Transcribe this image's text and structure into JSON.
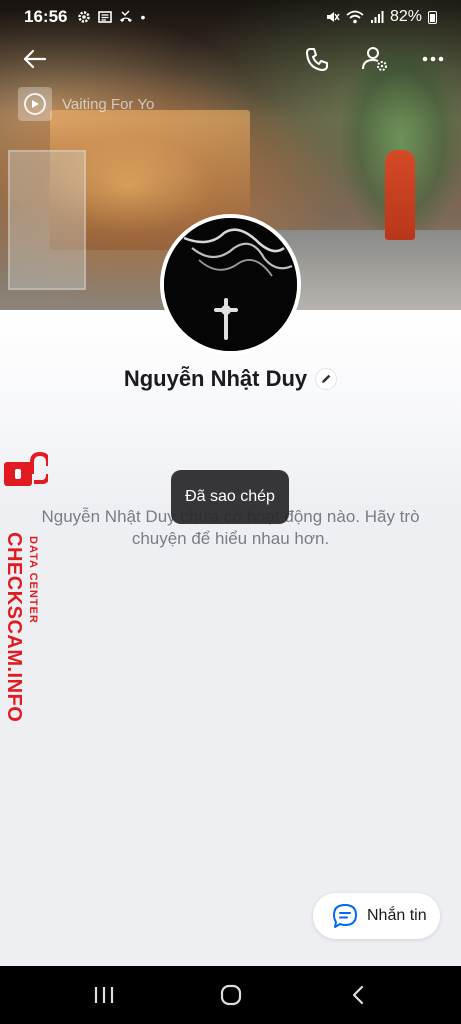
{
  "status_bar": {
    "time": "16:56",
    "dot": "•",
    "battery": "82%",
    "left_icons": [
      "gear-icon",
      "news-icon",
      "missed-call-icon"
    ],
    "right_icons": [
      "mute-icon",
      "wifi-icon",
      "signal-icon",
      "battery-icon"
    ]
  },
  "music": {
    "song": "Vaiting For Yo"
  },
  "profile": {
    "name": "Nguyễn Nhật Duy"
  },
  "empty_state": {
    "text": "Nguyễn Nhật Duy chưa có hoạt động nào. Hãy trò chuyện để hiểu nhau hơn."
  },
  "toast": {
    "text": "Đã sao chép"
  },
  "watermark": {
    "main": "CHECKSCAM.INFO",
    "sub": "DATA CENTER"
  },
  "actions": {
    "message_label": "Nhắn tin"
  },
  "colors": {
    "accent": "#0068ff",
    "watermark": "#e21b23"
  }
}
